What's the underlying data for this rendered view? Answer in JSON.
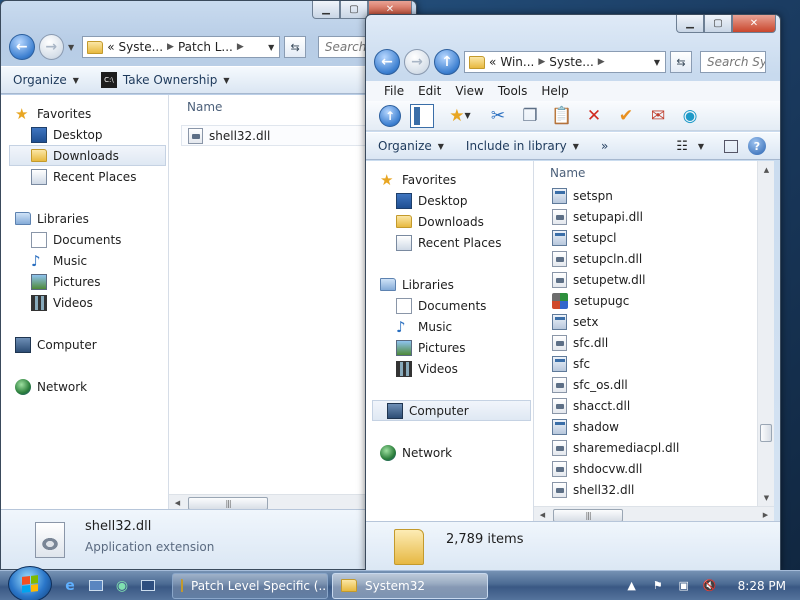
{
  "back_window": {
    "address": {
      "prefix": "«",
      "crumbs": [
        "Syste...",
        "Patch L..."
      ]
    },
    "search_placeholder": "Search P",
    "command_bar": {
      "organize": "Organize",
      "take_ownership": "Take Ownership"
    },
    "nav": {
      "favorites": "Favorites",
      "favorites_items": [
        "Desktop",
        "Downloads",
        "Recent Places"
      ],
      "libraries": "Libraries",
      "libraries_items": [
        "Documents",
        "Music",
        "Pictures",
        "Videos"
      ],
      "computer": "Computer",
      "network": "Network"
    },
    "column_header": "Name",
    "files": [
      "shell32.dll"
    ],
    "details": {
      "name": "shell32.dll",
      "type": "Application extension"
    }
  },
  "front_window": {
    "address": {
      "prefix": "«",
      "crumbs": [
        "Win...",
        "Syste..."
      ]
    },
    "search_placeholder": "Search Syst",
    "menu": [
      "File",
      "Edit",
      "View",
      "Tools",
      "Help"
    ],
    "command_bar": {
      "organize": "Organize",
      "include_in_library": "Include in library",
      "more": "»"
    },
    "nav": {
      "favorites": "Favorites",
      "favorites_items": [
        "Desktop",
        "Downloads",
        "Recent Places"
      ],
      "libraries": "Libraries",
      "libraries_items": [
        "Documents",
        "Music",
        "Pictures",
        "Videos"
      ],
      "computer": "Computer",
      "network": "Network"
    },
    "column_header": "Name",
    "files": [
      {
        "name": "setspn",
        "kind": "exe"
      },
      {
        "name": "setupapi.dll",
        "kind": "dll"
      },
      {
        "name": "setupcl",
        "kind": "exe"
      },
      {
        "name": "setupcln.dll",
        "kind": "dll"
      },
      {
        "name": "setupetw.dll",
        "kind": "dll"
      },
      {
        "name": "setupugc",
        "kind": "util"
      },
      {
        "name": "setx",
        "kind": "exe"
      },
      {
        "name": "sfc.dll",
        "kind": "dll"
      },
      {
        "name": "sfc",
        "kind": "exe"
      },
      {
        "name": "sfc_os.dll",
        "kind": "dll"
      },
      {
        "name": "shacct.dll",
        "kind": "dll"
      },
      {
        "name": "shadow",
        "kind": "exe"
      },
      {
        "name": "sharemediacpl.dll",
        "kind": "dll"
      },
      {
        "name": "shdocvw.dll",
        "kind": "dll"
      },
      {
        "name": "shell32.dll",
        "kind": "dll"
      }
    ],
    "vertical_scroll_position": 0.84,
    "status": {
      "items_count": "2,789 items"
    }
  },
  "taskbar": {
    "tasks": [
      "Patch Level Specific (...",
      "System32"
    ],
    "clock": "8:28 PM"
  }
}
